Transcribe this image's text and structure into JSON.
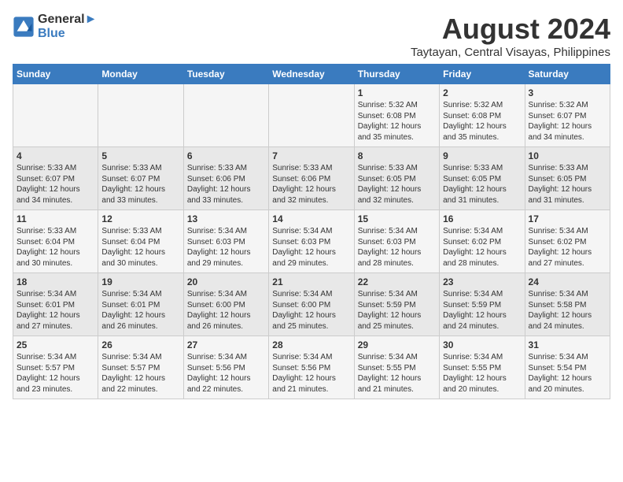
{
  "logo": {
    "line1": "General",
    "line2": "Blue"
  },
  "title": "August 2024",
  "subtitle": "Taytayan, Central Visayas, Philippines",
  "days_of_week": [
    "Sunday",
    "Monday",
    "Tuesday",
    "Wednesday",
    "Thursday",
    "Friday",
    "Saturday"
  ],
  "weeks": [
    [
      {
        "day": "",
        "content": ""
      },
      {
        "day": "",
        "content": ""
      },
      {
        "day": "",
        "content": ""
      },
      {
        "day": "",
        "content": ""
      },
      {
        "day": "1",
        "content": "Sunrise: 5:32 AM\nSunset: 6:08 PM\nDaylight: 12 hours\nand 35 minutes."
      },
      {
        "day": "2",
        "content": "Sunrise: 5:32 AM\nSunset: 6:08 PM\nDaylight: 12 hours\nand 35 minutes."
      },
      {
        "day": "3",
        "content": "Sunrise: 5:32 AM\nSunset: 6:07 PM\nDaylight: 12 hours\nand 34 minutes."
      }
    ],
    [
      {
        "day": "4",
        "content": "Sunrise: 5:33 AM\nSunset: 6:07 PM\nDaylight: 12 hours\nand 34 minutes."
      },
      {
        "day": "5",
        "content": "Sunrise: 5:33 AM\nSunset: 6:07 PM\nDaylight: 12 hours\nand 33 minutes."
      },
      {
        "day": "6",
        "content": "Sunrise: 5:33 AM\nSunset: 6:06 PM\nDaylight: 12 hours\nand 33 minutes."
      },
      {
        "day": "7",
        "content": "Sunrise: 5:33 AM\nSunset: 6:06 PM\nDaylight: 12 hours\nand 32 minutes."
      },
      {
        "day": "8",
        "content": "Sunrise: 5:33 AM\nSunset: 6:05 PM\nDaylight: 12 hours\nand 32 minutes."
      },
      {
        "day": "9",
        "content": "Sunrise: 5:33 AM\nSunset: 6:05 PM\nDaylight: 12 hours\nand 31 minutes."
      },
      {
        "day": "10",
        "content": "Sunrise: 5:33 AM\nSunset: 6:05 PM\nDaylight: 12 hours\nand 31 minutes."
      }
    ],
    [
      {
        "day": "11",
        "content": "Sunrise: 5:33 AM\nSunset: 6:04 PM\nDaylight: 12 hours\nand 30 minutes."
      },
      {
        "day": "12",
        "content": "Sunrise: 5:33 AM\nSunset: 6:04 PM\nDaylight: 12 hours\nand 30 minutes."
      },
      {
        "day": "13",
        "content": "Sunrise: 5:34 AM\nSunset: 6:03 PM\nDaylight: 12 hours\nand 29 minutes."
      },
      {
        "day": "14",
        "content": "Sunrise: 5:34 AM\nSunset: 6:03 PM\nDaylight: 12 hours\nand 29 minutes."
      },
      {
        "day": "15",
        "content": "Sunrise: 5:34 AM\nSunset: 6:03 PM\nDaylight: 12 hours\nand 28 minutes."
      },
      {
        "day": "16",
        "content": "Sunrise: 5:34 AM\nSunset: 6:02 PM\nDaylight: 12 hours\nand 28 minutes."
      },
      {
        "day": "17",
        "content": "Sunrise: 5:34 AM\nSunset: 6:02 PM\nDaylight: 12 hours\nand 27 minutes."
      }
    ],
    [
      {
        "day": "18",
        "content": "Sunrise: 5:34 AM\nSunset: 6:01 PM\nDaylight: 12 hours\nand 27 minutes."
      },
      {
        "day": "19",
        "content": "Sunrise: 5:34 AM\nSunset: 6:01 PM\nDaylight: 12 hours\nand 26 minutes."
      },
      {
        "day": "20",
        "content": "Sunrise: 5:34 AM\nSunset: 6:00 PM\nDaylight: 12 hours\nand 26 minutes."
      },
      {
        "day": "21",
        "content": "Sunrise: 5:34 AM\nSunset: 6:00 PM\nDaylight: 12 hours\nand 25 minutes."
      },
      {
        "day": "22",
        "content": "Sunrise: 5:34 AM\nSunset: 5:59 PM\nDaylight: 12 hours\nand 25 minutes."
      },
      {
        "day": "23",
        "content": "Sunrise: 5:34 AM\nSunset: 5:59 PM\nDaylight: 12 hours\nand 24 minutes."
      },
      {
        "day": "24",
        "content": "Sunrise: 5:34 AM\nSunset: 5:58 PM\nDaylight: 12 hours\nand 24 minutes."
      }
    ],
    [
      {
        "day": "25",
        "content": "Sunrise: 5:34 AM\nSunset: 5:57 PM\nDaylight: 12 hours\nand 23 minutes."
      },
      {
        "day": "26",
        "content": "Sunrise: 5:34 AM\nSunset: 5:57 PM\nDaylight: 12 hours\nand 22 minutes."
      },
      {
        "day": "27",
        "content": "Sunrise: 5:34 AM\nSunset: 5:56 PM\nDaylight: 12 hours\nand 22 minutes."
      },
      {
        "day": "28",
        "content": "Sunrise: 5:34 AM\nSunset: 5:56 PM\nDaylight: 12 hours\nand 21 minutes."
      },
      {
        "day": "29",
        "content": "Sunrise: 5:34 AM\nSunset: 5:55 PM\nDaylight: 12 hours\nand 21 minutes."
      },
      {
        "day": "30",
        "content": "Sunrise: 5:34 AM\nSunset: 5:55 PM\nDaylight: 12 hours\nand 20 minutes."
      },
      {
        "day": "31",
        "content": "Sunrise: 5:34 AM\nSunset: 5:54 PM\nDaylight: 12 hours\nand 20 minutes."
      }
    ]
  ]
}
